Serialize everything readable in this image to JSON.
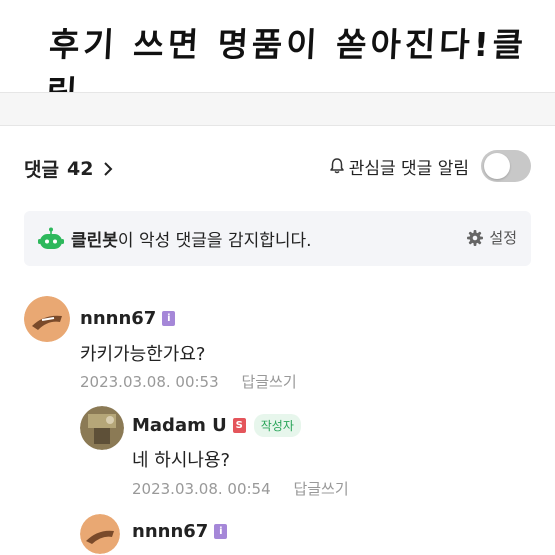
{
  "banner": {
    "text": "후기 쓰면 명품이 쏟아진다!클릭"
  },
  "comments_header": {
    "label": "댓글",
    "count": "42"
  },
  "alarm": {
    "label": "관심글 댓글 알림",
    "toggle_on": false
  },
  "cleanbot": {
    "name": "클린봇",
    "message": "이 악성 댓글을 감지합니다.",
    "setting_label": "설정",
    "accent": "#2db85c"
  },
  "comments": [
    {
      "author": "nnnn67",
      "badge": "i",
      "text": "카키가능한가요?",
      "date": "2023.03.08. 00:53",
      "reply_label": "답글쓰기"
    },
    {
      "author": "Madam U",
      "badge": "S",
      "writer_tag": "작성자",
      "text": "네 하시나용?",
      "date": "2023.03.08. 00:54",
      "reply_label": "답글쓰기"
    },
    {
      "author": "nnnn67",
      "badge": "i"
    }
  ]
}
